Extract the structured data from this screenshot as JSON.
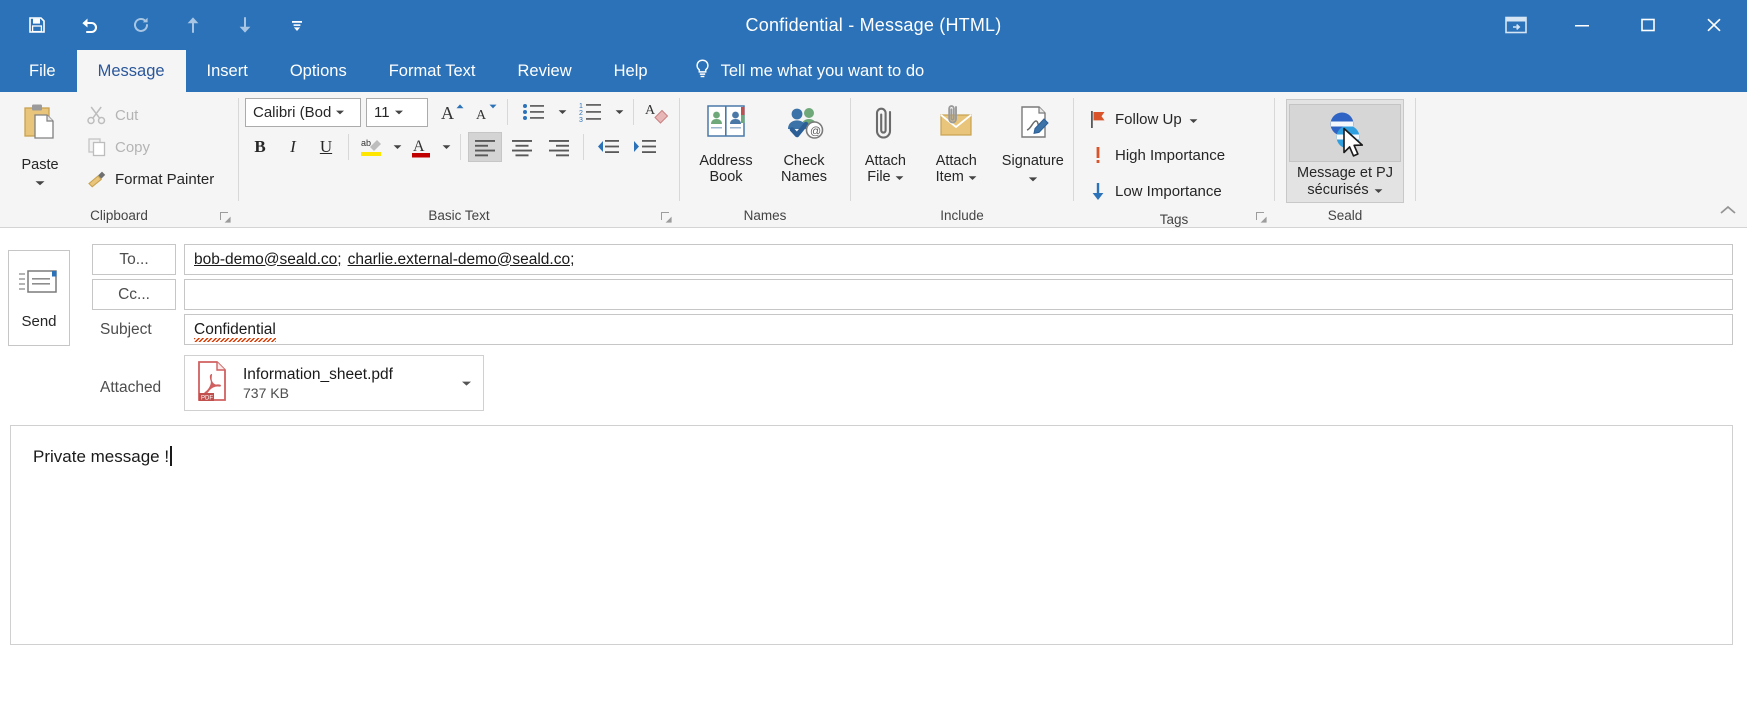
{
  "window": {
    "title": "Confidential  -  Message (HTML)",
    "accent_color": "#2b72b8",
    "quick_access": [
      {
        "name": "save-icon",
        "label": "Save"
      },
      {
        "name": "undo-icon",
        "label": "Undo"
      },
      {
        "name": "redo-icon",
        "label": "Redo"
      },
      {
        "name": "previous-item-icon",
        "label": "Previous Item"
      },
      {
        "name": "next-item-icon",
        "label": "Next Item"
      },
      {
        "name": "customize-quick-access-toolbar-icon",
        "label": "Customize Quick Access Toolbar"
      }
    ],
    "controls": [
      {
        "name": "ribbon-display-options",
        "label": "Ribbon Display Options"
      },
      {
        "name": "minimize",
        "label": "Minimize"
      },
      {
        "name": "maximize",
        "label": "Maximize"
      },
      {
        "name": "close",
        "label": "Close"
      }
    ]
  },
  "tabs": [
    {
      "label": "File",
      "active": false
    },
    {
      "label": "Message",
      "active": true
    },
    {
      "label": "Insert",
      "active": false
    },
    {
      "label": "Options",
      "active": false
    },
    {
      "label": "Format Text",
      "active": false
    },
    {
      "label": "Review",
      "active": false
    },
    {
      "label": "Help",
      "active": false
    }
  ],
  "tell_me": "Tell me what you want to do",
  "ribbon": {
    "clipboard": {
      "group_label": "Clipboard",
      "paste": "Paste",
      "cut": "Cut",
      "copy": "Copy",
      "format_painter": "Format Painter"
    },
    "basic_text": {
      "group_label": "Basic Text",
      "font_name": "Calibri (Bod",
      "font_size": "11",
      "bold": "B",
      "italic": "I",
      "underline": "U",
      "highlight_color": "#ffe600",
      "font_color": "#c00000",
      "align_active": "left"
    },
    "names": {
      "group_label": "Names",
      "address_book": "Address\nBook",
      "address_book_line1": "Address",
      "address_book_line2": "Book",
      "check_names_line1": "Check",
      "check_names_line2": "Names"
    },
    "include": {
      "group_label": "Include",
      "attach_file_line1": "Attach",
      "attach_file_line2": "File",
      "attach_item_line1": "Attach",
      "attach_item_line2": "Item",
      "signature": "Signature"
    },
    "tags": {
      "group_label": "Tags",
      "follow_up": "Follow Up",
      "high_importance": "High Importance",
      "low_importance": "Low Importance"
    },
    "seald": {
      "group_label": "Seald",
      "button_line1": "Message et PJ",
      "button_line2": "sécurisés",
      "icon_name": "seald-logo-icon",
      "state": "hovered"
    }
  },
  "compose": {
    "send_label": "Send",
    "to_label": "To...",
    "cc_label": "Cc...",
    "subject_label": "Subject",
    "attached_label": "Attached",
    "to_value": "bob-demo@seald.co; charlie.external-demo@seald.co;",
    "to_recipients": [
      "bob-demo@seald.co;",
      "charlie.external-demo@seald.co;"
    ],
    "cc_value": "",
    "subject_value": "Confidential",
    "attachment": {
      "file_name": "Information_sheet.pdf",
      "file_size": "737 KB",
      "file_type": "pdf"
    },
    "body_text": "Private message !"
  }
}
